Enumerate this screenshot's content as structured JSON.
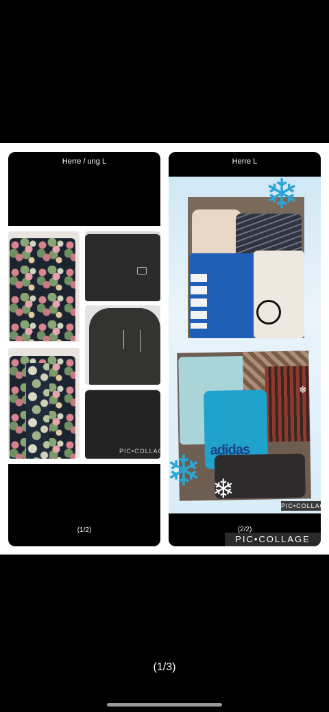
{
  "viewer": {
    "page_counter": "(1/3)"
  },
  "collage": {
    "left_card": {
      "title": "Herre / ung L",
      "pager": "(1/2)",
      "watermark": "PIC•COLLAGE"
    },
    "right_card": {
      "title": "Herre L",
      "pager": "(2/2)",
      "watermark": "PIC•COLLAGE",
      "photo_watermark": "PIC•COLLAGE",
      "adidas_text": "adidas"
    }
  },
  "colors": {
    "background": "#000000",
    "collage_background": "#ffffff",
    "snow_accent": "#2aa6d6"
  },
  "icons": {
    "snowflake": "snowflake-icon"
  }
}
